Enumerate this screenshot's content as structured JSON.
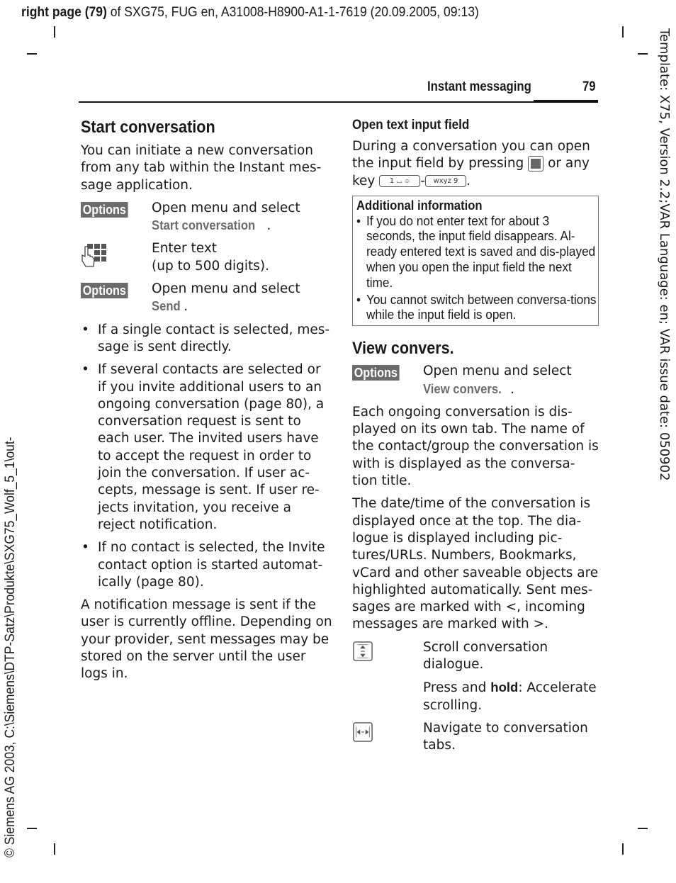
{
  "meta": {
    "top_bold": "right page (79)",
    "top_rest": " of SXG75, FUG en, A31008-H8900-A1-1-7619 (20.09.2005, 09:13)",
    "side_left": "© Siemens AG 2003, C:\\Siemens\\DTP-Satz\\Produkte\\SXG75_Wolf_5_1\\out-",
    "side_right": "Template: X75, Version 2.2;VAR Language: en; VAR issue date: 050902"
  },
  "header": {
    "title": "Instant messaging",
    "page_number": "79"
  },
  "left": {
    "heading": "Start conversation",
    "intro": "You can initiate a new conversation from any tab within the Instant mes-sage application.",
    "steps": [
      {
        "key": "Options",
        "key_type": "softkey",
        "text": "Open menu and select",
        "menu": "Start conversation",
        "suffix": "."
      },
      {
        "key": "keypad-hand-icon",
        "key_type": "icon",
        "text": "Enter text",
        "text2": "(up to 500 digits)."
      },
      {
        "key": "Options",
        "key_type": "softkey",
        "text": "Open menu and select",
        "menu": "Send",
        "suffix": "."
      }
    ],
    "bullets": [
      "If a single contact is selected, mes-sage is sent directly.",
      "If several contacts are selected or if you invite additional users to an ongoing conversation (page 80), a conversation request is sent to each user. The invited users have to accept the request in order to join the conversation. If user ac-cepts, message is sent. If user re-jects invitation, you receive a reject notification.",
      "If no contact is selected, the Invite contact option is started automat-ically (page 80)."
    ],
    "closing": "A notification message is sent if the user is currently offline. Depending on your provider, sent messages may be stored on the server until the user logs in."
  },
  "right": {
    "subheading": "Open text input field",
    "input_text_a": "During a conversation you can open the input field by pressing",
    "input_text_b": "or any key",
    "key_first": "1 ⌴ ⌯",
    "key_last": "wxyz 9",
    "dash": "-",
    "period": ".",
    "info": {
      "title": "Additional information",
      "bullets": [
        "If you do not enter text for about 3 seconds, the input field disappears. Al-ready entered text is saved and dis-played when you open the input field the next time.",
        "You cannot switch between conversa-tions while the input field is open."
      ]
    },
    "heading2": "View convers.",
    "step": {
      "key": "Options",
      "text": "Open menu and select",
      "menu": "View convers.",
      "suffix": "."
    },
    "para1": "Each ongoing conversation is dis-played on its own tab. The name of the contact/group the conversation is with is displayed as the conversa-tion title.",
    "para2": "The date/time of the conversation is displayed once at the top. The dia-logue is displayed including pic-tures/URLs. Numbers, Bookmarks, vCard and other saveable objects are highlighted automatically. Sent mes-sages are marked with <, incoming messages are marked with >.",
    "nav": [
      {
        "icon": "scroll-up-down-icon",
        "text": "Scroll conversation dialogue.",
        "extra_pre": "Press and ",
        "extra_bold": "hold",
        "extra_post": ": Accelerate scrolling."
      },
      {
        "icon": "navigate-left-right-icon",
        "text": "Navigate to conversation tabs."
      }
    ]
  }
}
